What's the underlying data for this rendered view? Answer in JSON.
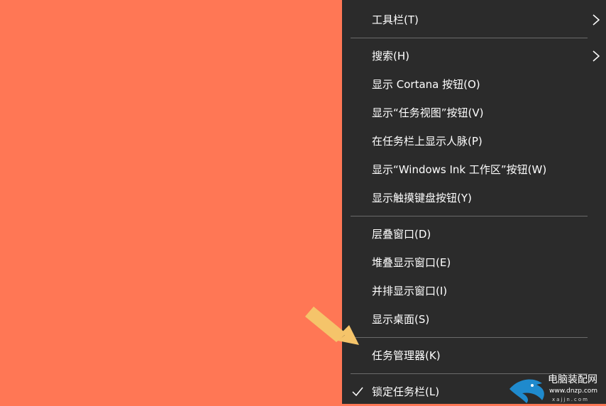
{
  "menu": {
    "items": [
      {
        "label": "工具栏(T)",
        "has_submenu": true
      },
      {
        "label": "搜索(H)",
        "has_submenu": true
      },
      {
        "label": "显示 Cortana 按钮(O)"
      },
      {
        "label": "显示“任务视图”按钮(V)"
      },
      {
        "label": "在任务栏上显示人脉(P)"
      },
      {
        "label": "显示“Windows Ink 工作区”按钮(W)"
      },
      {
        "label": "显示触摸键盘按钮(Y)"
      },
      {
        "label": "层叠窗口(D)"
      },
      {
        "label": "堆叠显示窗口(E)"
      },
      {
        "label": "并排显示窗口(I)"
      },
      {
        "label": "显示桌面(S)"
      },
      {
        "label": "任务管理器(K)"
      },
      {
        "label": "锁定任务栏(L)",
        "checked": true
      }
    ]
  },
  "colors": {
    "desktop_background": "#ff7755",
    "menu_background": "#2b2b2b",
    "menu_text": "#ffffff",
    "separator": "#6a6a6a",
    "annotation_arrow": "#f5c46a"
  },
  "icons": {
    "submenu_arrow": "chevron-right-icon",
    "checked": "checkmark-icon",
    "annotation": "arrow-annotation-icon"
  },
  "watermark": {
    "lines": [
      "电脑装配网",
      "www.dnzp.com",
      "xajjn.com"
    ]
  }
}
